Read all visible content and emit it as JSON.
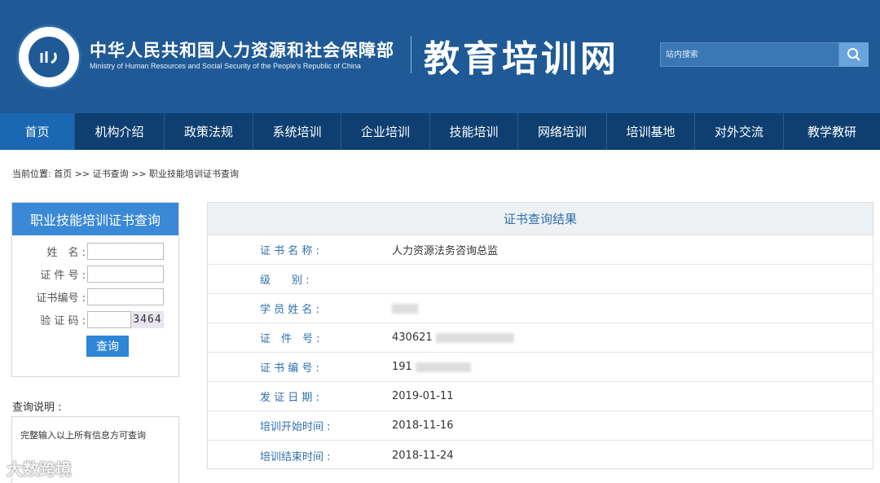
{
  "header": {
    "org_cn": "中华人民共和国人力资源和社会保障部",
    "org_en": "Ministry of Human Resources and Social Security of the People's Republic of China",
    "site_title": "教育培训网",
    "search_placeholder": "站内搜索",
    "colors": {
      "header_bg": "#1f5a96",
      "nav_bg": "#0e3f70",
      "nav_active": "#1a67b3"
    }
  },
  "nav": {
    "items": [
      {
        "label": "首页",
        "active": true
      },
      {
        "label": "机构介绍"
      },
      {
        "label": "政策法规"
      },
      {
        "label": "系统培训"
      },
      {
        "label": "企业培训"
      },
      {
        "label": "技能培训"
      },
      {
        "label": "网络培训"
      },
      {
        "label": "培训基地"
      },
      {
        "label": "对外交流"
      },
      {
        "label": "教学教研"
      }
    ]
  },
  "breadcrumb": "当前位置: 首页 >> 证书查询 >> 职业技能培训证书查询",
  "query_form": {
    "title": "职业技能培训证书查询",
    "name_label": "姓　名 :",
    "id_label": "证 件 号 :",
    "cert_label": "证书编号 :",
    "captcha_label": "验 证 码 :",
    "captcha_value": "3464",
    "submit_label": "查询"
  },
  "note": {
    "title": "查询说明 :",
    "text": "完整输入以上所有信息方可查询"
  },
  "result": {
    "header": "证书查询结果",
    "rows": [
      {
        "label": "证 书 名 称 :",
        "value": "人力资源法务咨询总监"
      },
      {
        "label": "级　　别 :",
        "value": ""
      },
      {
        "label": "学 员 姓 名 :",
        "value": ""
      },
      {
        "label": "证　件　号 :",
        "value": "430621"
      },
      {
        "label": "证 书 编 号 :",
        "value": "191"
      },
      {
        "label": "发 证 日 期 :",
        "value": "2019-01-11"
      },
      {
        "label": "培训开始时间 :",
        "value": "2018-11-16"
      },
      {
        "label": "培训结束时间 :",
        "value": "2018-11-24"
      }
    ]
  },
  "watermark": "大数跨境"
}
